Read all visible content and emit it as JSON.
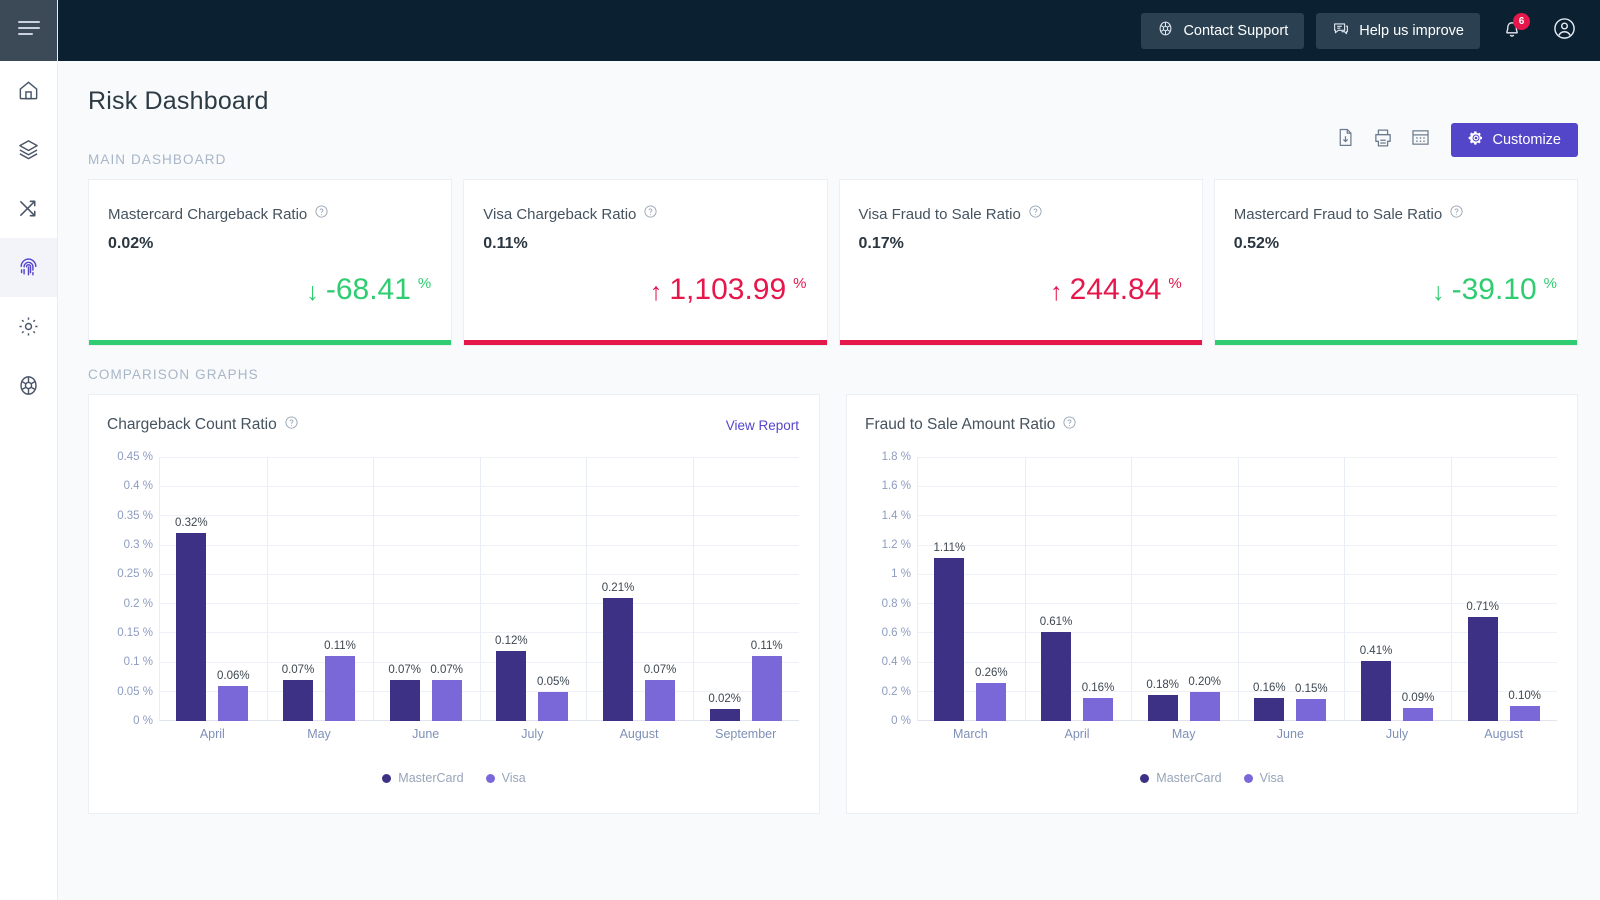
{
  "sidebar": {
    "menu_icon": "hamburger-menu-icon",
    "items": [
      {
        "name": "home",
        "icon": "home-icon",
        "active": false
      },
      {
        "name": "layers",
        "icon": "layers-icon",
        "active": false
      },
      {
        "name": "transactions",
        "icon": "shuffle-icon",
        "active": false
      },
      {
        "name": "risk",
        "icon": "fingerprint-icon",
        "active": true
      },
      {
        "name": "settings",
        "icon": "gear-icon",
        "active": false
      },
      {
        "name": "support",
        "icon": "lifebuoy-icon",
        "active": false
      }
    ]
  },
  "topbar": {
    "contact_support_label": "Contact Support",
    "contact_support_icon": "lifebuoy-icon",
    "help_label": "Help us improve",
    "help_icon": "chat-icon",
    "notification_icon": "bell-icon",
    "notification_count": "6",
    "account_icon": "user-circle-icon"
  },
  "page": {
    "title": "Risk Dashboard",
    "section_main": "MAIN DASHBOARD",
    "section_comparison": "COMPARISON GRAPHS"
  },
  "toolbar": {
    "export_icon": "file-download-icon",
    "print_icon": "printer-icon",
    "table_icon": "grid-table-icon",
    "customize_label": "Customize",
    "customize_icon": "gear-icon",
    "customize_color": "#5346c8"
  },
  "kpis": [
    {
      "title": "Mastercard Chargeback Ratio",
      "help_icon": "question-circle-icon",
      "value": "0.02%",
      "arrow": "↓",
      "delta": "-68.41",
      "unit": "%",
      "direction": "down",
      "color": "#2fcc71"
    },
    {
      "title": "Visa Chargeback Ratio",
      "help_icon": "question-circle-icon",
      "value": "0.11%",
      "arrow": "↑",
      "delta": "1,103.99",
      "unit": "%",
      "direction": "up",
      "color": "#e5174b"
    },
    {
      "title": "Visa Fraud to Sale Ratio",
      "help_icon": "question-circle-icon",
      "value": "0.17%",
      "arrow": "↑",
      "delta": "244.84",
      "unit": "%",
      "direction": "up",
      "color": "#e5174b"
    },
    {
      "title": "Mastercard Fraud to Sale Ratio",
      "help_icon": "question-circle-icon",
      "value": "0.52%",
      "arrow": "↓",
      "delta": "-39.10",
      "unit": "%",
      "direction": "down",
      "color": "#2fcc71"
    }
  ],
  "charts": [
    {
      "title": "Chargeback Count Ratio",
      "help_icon": "question-circle-icon",
      "view_report_label": "View Report",
      "has_view_report": true
    },
    {
      "title": "Fraud to Sale Amount Ratio",
      "help_icon": "question-circle-icon",
      "view_report_label": "",
      "has_view_report": false
    }
  ],
  "chart_data": [
    {
      "type": "bar",
      "title": "Chargeback Count Ratio",
      "xlabel": "",
      "ylabel": "",
      "ylim": [
        0,
        0.45
      ],
      "ytick_labels": [
        "0 %",
        "0.05 %",
        "0.1 %",
        "0.15 %",
        "0.2 %",
        "0.25 %",
        "0.3 %",
        "0.35 %",
        "0.4 %",
        "0.45 %"
      ],
      "ytick_values": [
        0,
        0.05,
        0.1,
        0.15,
        0.2,
        0.25,
        0.3,
        0.35,
        0.4,
        0.45
      ],
      "grid": true,
      "legend_position": "bottom",
      "categories": [
        "April",
        "May",
        "June",
        "July",
        "August",
        "September"
      ],
      "series": [
        {
          "name": "MasterCard",
          "color": "#3c3184",
          "values": [
            0.32,
            0.07,
            0.07,
            0.12,
            0.21,
            0.02
          ],
          "labels": [
            "0.32%",
            "0.07%",
            "0.07%",
            "0.12%",
            "0.21%",
            "0.02%"
          ]
        },
        {
          "name": "Visa",
          "color": "#7a68d8",
          "values": [
            0.06,
            0.11,
            0.07,
            0.05,
            0.07,
            0.11
          ],
          "labels": [
            "0.06%",
            "0.11%",
            "0.07%",
            "0.05%",
            "0.07%",
            "0.11%"
          ]
        }
      ]
    },
    {
      "type": "bar",
      "title": "Fraud to Sale Amount Ratio",
      "xlabel": "",
      "ylabel": "",
      "ylim": [
        0,
        1.8
      ],
      "ytick_labels": [
        "0 %",
        "0.2 %",
        "0.4 %",
        "0.6 %",
        "0.8 %",
        "1 %",
        "1.2 %",
        "1.4 %",
        "1.6 %",
        "1.8 %"
      ],
      "ytick_values": [
        0,
        0.2,
        0.4,
        0.6,
        0.8,
        1.0,
        1.2,
        1.4,
        1.6,
        1.8
      ],
      "grid": true,
      "legend_position": "bottom",
      "categories": [
        "March",
        "April",
        "May",
        "June",
        "July",
        "August"
      ],
      "series": [
        {
          "name": "MasterCard",
          "color": "#3c3184",
          "values": [
            1.11,
            0.61,
            0.18,
            0.16,
            0.41,
            0.71
          ],
          "labels": [
            "1.11%",
            "0.61%",
            "0.18%",
            "0.16%",
            "0.41%",
            "0.71%"
          ]
        },
        {
          "name": "Visa",
          "color": "#7a68d8",
          "values": [
            0.26,
            0.16,
            0.2,
            0.15,
            0.09,
            0.1
          ],
          "labels": [
            "0.26%",
            "0.16%",
            "0.20%",
            "0.15%",
            "0.09%",
            "0.10%"
          ]
        }
      ]
    }
  ],
  "legend": {
    "mastercard_label": "MasterCard",
    "visa_label": "Visa",
    "mastercard_color": "#3c3184",
    "visa_color": "#7a68d8"
  }
}
